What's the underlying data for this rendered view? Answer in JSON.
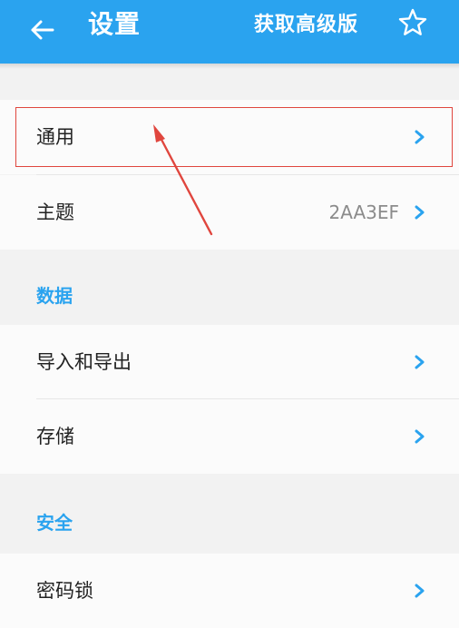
{
  "appbar": {
    "title": "设置",
    "upgrade_label": "获取高级版",
    "back_icon": "arrow-left-icon",
    "star_icon": "star-outline-icon",
    "accent_color": "#2AA3EF"
  },
  "general": {
    "items": [
      {
        "label": "通用",
        "value": ""
      },
      {
        "label": "主题",
        "value": "2AA3EF"
      }
    ]
  },
  "data_section": {
    "header": "数据",
    "items": [
      {
        "label": "导入和导出"
      },
      {
        "label": "存储"
      }
    ]
  },
  "security_section": {
    "header": "安全",
    "items": [
      {
        "label": "密码锁"
      }
    ]
  },
  "annotation": {
    "color": "#E0463E"
  }
}
